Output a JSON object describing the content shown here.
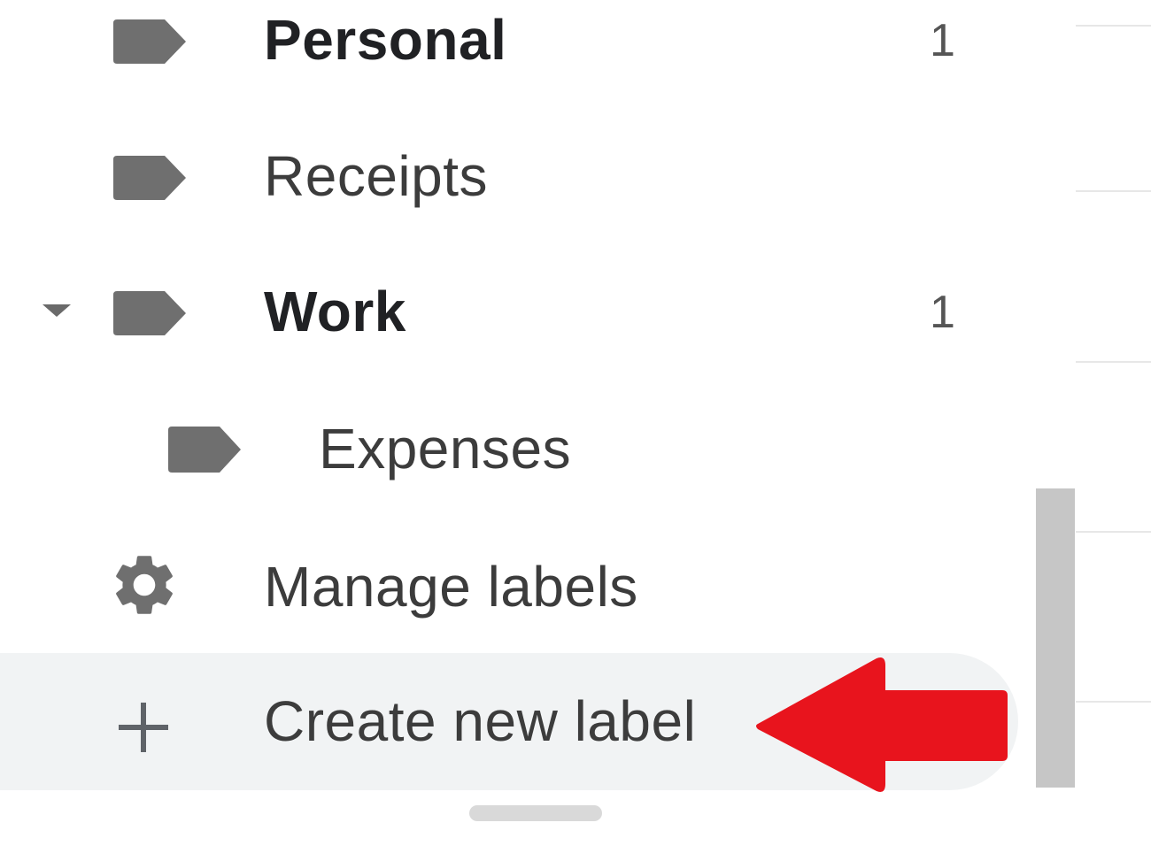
{
  "labels": {
    "items": [
      {
        "name": "Personal",
        "count": "1",
        "bold": true
      },
      {
        "name": "Receipts",
        "count": "",
        "bold": false
      },
      {
        "name": "Work",
        "count": "1",
        "bold": true
      },
      {
        "name": "Expenses",
        "count": "",
        "bold": false
      }
    ]
  },
  "actions": {
    "manage_labels": "Manage labels",
    "create_new_label": "Create new label"
  },
  "icons": {
    "label": "label-icon",
    "expand": "caret-down-icon",
    "manage": "gear-icon",
    "create": "plus-icon",
    "annotation": "red-arrow-icon"
  },
  "colors": {
    "icon": "#6f6f6f",
    "hover_bg": "#f1f3f4",
    "annotation_arrow": "#e8141d",
    "scrollbar": "#c6c6c6"
  }
}
